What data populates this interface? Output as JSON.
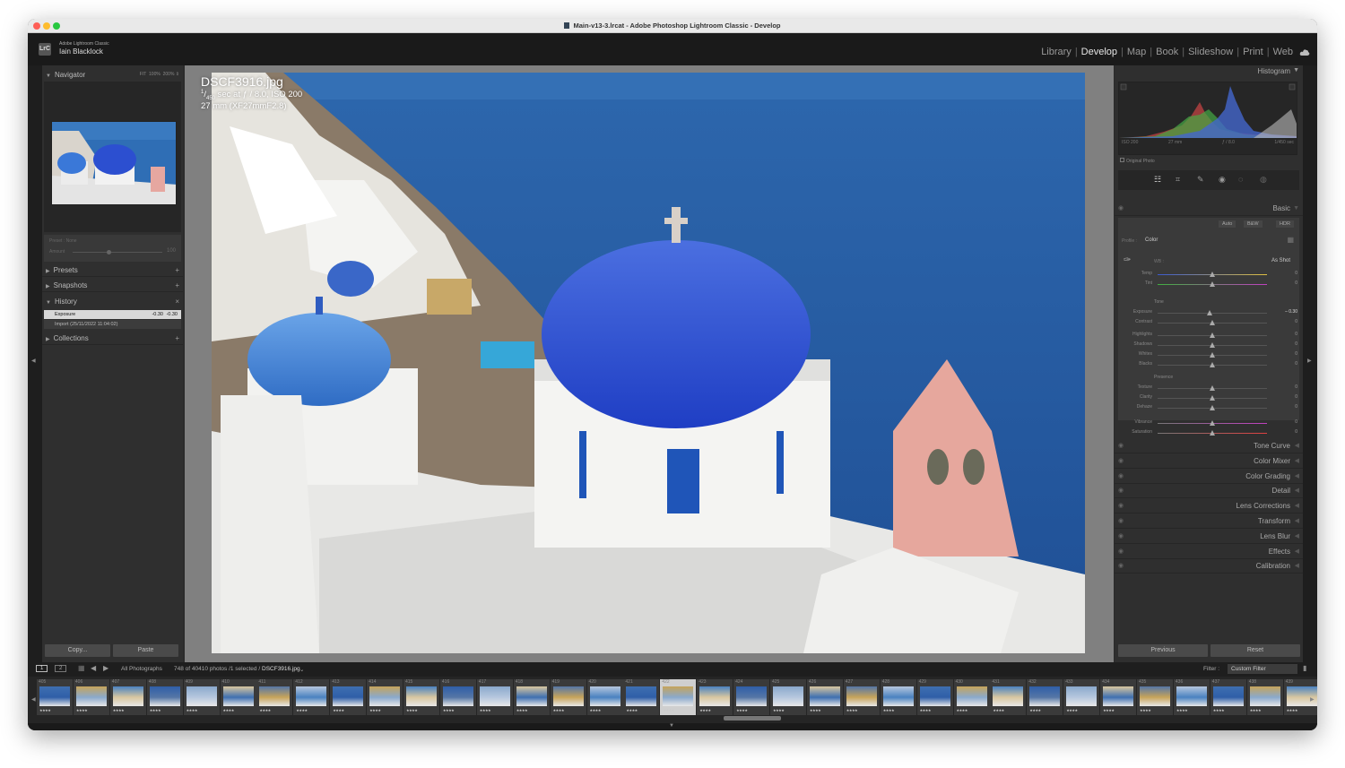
{
  "window": {
    "title": "Main-v13-3.lrcat - Adobe Photoshop Lightroom Classic - Develop"
  },
  "identity": {
    "app_name": "Adobe Lightroom Classic",
    "user_name": "Iain Blacklock",
    "logo_text": "LrC"
  },
  "modules": [
    {
      "label": "Library",
      "active": false
    },
    {
      "label": "Develop",
      "active": true
    },
    {
      "label": "Map",
      "active": false
    },
    {
      "label": "Book",
      "active": false
    },
    {
      "label": "Slideshow",
      "active": false
    },
    {
      "label": "Print",
      "active": false
    },
    {
      "label": "Web",
      "active": false
    }
  ],
  "left_panel": {
    "navigator": {
      "title": "Navigator",
      "zoom_options": [
        "FIT",
        "100%",
        "200%"
      ]
    },
    "preset": {
      "label": "Preset : None",
      "amount_label": "Amount",
      "amount_value": "100"
    },
    "presets_label": "Presets",
    "snapshots_label": "Snapshots",
    "history": {
      "title": "History",
      "items": [
        {
          "label": "Exposure",
          "from": "-0.30",
          "to": "-0.30",
          "selected": true
        },
        {
          "label": "Import (25/11/2022 11:04:02)",
          "selected": false
        }
      ]
    },
    "collections_label": "Collections",
    "copy_button": "Copy...",
    "paste_button": "Paste"
  },
  "photo_info": {
    "filename": "DSCF3916.jpg",
    "shutter_num": "1",
    "shutter_den": "450",
    "exposure_line": "sec at ƒ / 8.0, ISO 200",
    "lens_line": "27 mm (XF27mmF2.8)"
  },
  "right_panel": {
    "histogram": {
      "title": "Histogram",
      "iso": "ISO 200",
      "focal": "27 mm",
      "aperture": "ƒ / 8.0",
      "shutter": "1/450 sec",
      "original_photo_label": "Original Photo"
    },
    "basic": {
      "title": "Basic",
      "buttons": [
        "Auto",
        "B&W",
        "HDR"
      ],
      "profile_label": "Profile :",
      "profile_value": "Color",
      "wb_label": "WB :",
      "wb_value": "As Shot",
      "sliders_wb": [
        {
          "label": "Temp",
          "value": "0"
        },
        {
          "label": "Tint",
          "value": "0"
        }
      ],
      "tone_label": "Tone",
      "sliders_tone": [
        {
          "label": "Exposure",
          "value": "– 0.30"
        },
        {
          "label": "Contrast",
          "value": "0"
        }
      ],
      "sliders_tone2": [
        {
          "label": "Highlights",
          "value": "0"
        },
        {
          "label": "Shadows",
          "value": "0"
        },
        {
          "label": "Whites",
          "value": "0"
        },
        {
          "label": "Blacks",
          "value": "0"
        }
      ],
      "presence_label": "Presence",
      "sliders_presence": [
        {
          "label": "Texture",
          "value": "0"
        },
        {
          "label": "Clarity",
          "value": "0"
        },
        {
          "label": "Dehaze",
          "value": "0"
        }
      ],
      "sliders_color": [
        {
          "label": "Vibrance",
          "value": "0"
        },
        {
          "label": "Saturation",
          "value": "0"
        }
      ]
    },
    "sections": [
      "Tone Curve",
      "Color Mixer",
      "Color Grading",
      "Detail",
      "Lens Corrections",
      "Transform",
      "Lens Blur",
      "Effects",
      "Calibration"
    ],
    "previous_button": "Previous",
    "reset_button": "Reset"
  },
  "filmstrip_bar": {
    "screen1": "1",
    "screen2": "2",
    "source": "All Photographs",
    "count": "748 of 40410 photos /1 selected /",
    "current_file": "DSCF3916.jpg",
    "filter_label": "Filter :",
    "filter_value": "Custom Filter"
  },
  "filmstrip": {
    "numbers": [
      "405",
      "406",
      "407",
      "408",
      "409",
      "410",
      "411",
      "412",
      "413",
      "414",
      "415",
      "416",
      "417",
      "418",
      "419",
      "420",
      "421",
      "422",
      "423",
      "424",
      "425",
      "426",
      "427",
      "428",
      "429",
      "430",
      "431",
      "432",
      "433",
      "434",
      "435",
      "436",
      "437",
      "438",
      "439"
    ],
    "selected_index": 17
  }
}
